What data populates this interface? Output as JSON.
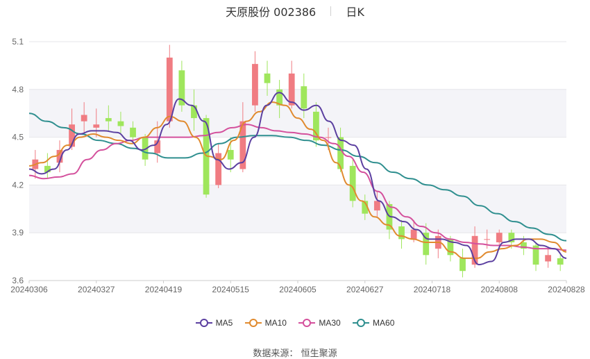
{
  "header": {
    "stock": "天原股份 002386",
    "period": "日K"
  },
  "source": {
    "prefix": "数据来源：",
    "name": "恒生聚源"
  },
  "chart_data": {
    "type": "candlestick",
    "title": "天原股份 002386",
    "period": "日K",
    "ylim": [
      3.6,
      5.1
    ],
    "y_ticks": [
      "3.6",
      "3.9",
      "4.2",
      "4.5",
      "4.8",
      "5.1"
    ],
    "x_ticks": [
      "20240306",
      "20240327",
      "20240419",
      "20240515",
      "20240605",
      "20240627",
      "20240718",
      "20240808",
      "20240828"
    ],
    "up_color": "#f07c82",
    "down_color": "#9fe65c",
    "legend_position": "bottom",
    "series": [
      {
        "name": "MA5",
        "color": "#5b3fa0"
      },
      {
        "name": "MA10",
        "color": "#e08a2e"
      },
      {
        "name": "MA30",
        "color": "#d4509c"
      },
      {
        "name": "MA60",
        "color": "#2f8f8f"
      }
    ],
    "ma5": [
      4.3,
      4.27,
      4.3,
      4.42,
      4.52,
      4.54,
      4.54,
      4.53,
      4.48,
      4.42,
      4.45,
      4.58,
      4.74,
      4.7,
      4.6,
      4.36,
      4.3,
      4.34,
      4.5,
      4.7,
      4.78,
      4.72,
      4.67,
      4.7,
      4.6,
      4.48,
      4.45,
      4.3,
      4.1,
      4.0,
      3.97,
      3.92,
      3.86,
      3.86,
      3.84,
      3.82,
      3.7,
      3.72,
      3.84,
      3.86,
      3.86,
      3.82,
      3.8,
      3.74
    ],
    "ma10": [
      4.32,
      4.34,
      4.38,
      4.45,
      4.5,
      4.52,
      4.5,
      4.48,
      4.46,
      4.5,
      4.56,
      4.63,
      4.6,
      4.5,
      4.38,
      4.36,
      4.48,
      4.6,
      4.66,
      4.72,
      4.7,
      4.62,
      4.55,
      4.48,
      4.34,
      4.2,
      4.1,
      4.0,
      3.95,
      3.88,
      3.86,
      3.84,
      3.84,
      3.78,
      3.74,
      3.74,
      3.78,
      3.8,
      3.82,
      3.86,
      3.86,
      3.84,
      3.78
    ],
    "ma30": [
      4.26,
      4.24,
      4.25,
      4.27,
      4.36,
      4.42,
      4.46,
      4.48,
      4.5,
      4.5,
      4.5,
      4.5,
      4.51,
      4.53,
      4.56,
      4.58,
      4.56,
      4.54,
      4.53,
      4.52,
      4.5,
      4.46,
      4.38,
      4.28,
      4.16,
      4.06,
      4.0,
      3.94,
      3.9,
      3.86,
      3.84,
      3.83,
      3.82,
      3.82,
      3.81,
      3.8,
      3.8,
      3.79
    ],
    "ma60": [
      4.65,
      4.6,
      4.56,
      4.52,
      4.48,
      4.46,
      4.43,
      4.4,
      4.37,
      4.37,
      4.4,
      4.46,
      4.5,
      4.51,
      4.51,
      4.5,
      4.48,
      4.45,
      4.42,
      4.38,
      4.34,
      4.28,
      4.24,
      4.2,
      4.17,
      4.13,
      4.07,
      4.02,
      3.97,
      3.93,
      3.89,
      3.85
    ],
    "candles": [
      [
        4.3,
        4.36,
        4.24,
        4.42
      ],
      [
        4.32,
        4.28,
        4.24,
        4.4
      ],
      [
        4.34,
        4.42,
        4.28,
        4.48
      ],
      [
        4.44,
        4.58,
        4.42,
        4.68
      ],
      [
        4.6,
        4.64,
        4.52,
        4.72
      ],
      [
        4.56,
        4.58,
        4.5,
        4.68
      ],
      [
        4.62,
        4.6,
        4.54,
        4.7
      ],
      [
        4.6,
        4.57,
        4.52,
        4.66
      ],
      [
        4.56,
        4.5,
        4.46,
        4.6
      ],
      [
        4.5,
        4.36,
        4.32,
        4.52
      ],
      [
        4.4,
        4.48,
        4.34,
        4.6
      ],
      [
        4.6,
        5.0,
        4.56,
        5.08
      ],
      [
        4.92,
        4.7,
        4.66,
        4.98
      ],
      [
        4.7,
        4.62,
        4.54,
        4.8
      ],
      [
        4.62,
        4.14,
        4.12,
        4.64
      ],
      [
        4.2,
        4.4,
        4.18,
        4.46
      ],
      [
        4.42,
        4.36,
        4.28,
        4.5
      ],
      [
        4.3,
        4.6,
        4.28,
        4.72
      ],
      [
        4.7,
        4.96,
        4.66,
        5.04
      ],
      [
        4.9,
        4.84,
        4.76,
        4.98
      ],
      [
        4.8,
        4.7,
        4.62,
        4.86
      ],
      [
        4.7,
        4.9,
        4.68,
        4.98
      ],
      [
        4.82,
        4.68,
        4.62,
        4.9
      ],
      [
        4.66,
        4.48,
        4.44,
        4.72
      ],
      [
        4.5,
        4.5,
        4.42,
        4.56
      ],
      [
        4.5,
        4.3,
        4.28,
        4.56
      ],
      [
        4.32,
        4.1,
        4.06,
        4.36
      ],
      [
        4.1,
        4.02,
        3.98,
        4.14
      ],
      [
        4.04,
        4.1,
        4.0,
        4.16
      ],
      [
        4.08,
        3.92,
        3.86,
        4.1
      ],
      [
        3.94,
        3.86,
        3.8,
        3.98
      ],
      [
        3.86,
        3.92,
        3.84,
        3.98
      ],
      [
        3.9,
        3.76,
        3.7,
        3.96
      ],
      [
        3.8,
        3.88,
        3.74,
        3.92
      ],
      [
        3.86,
        3.76,
        3.72,
        3.88
      ],
      [
        3.74,
        3.66,
        3.62,
        3.8
      ],
      [
        3.7,
        3.88,
        3.68,
        3.94
      ],
      [
        3.86,
        3.86,
        3.8,
        3.92
      ],
      [
        3.84,
        3.9,
        3.8,
        3.92
      ],
      [
        3.9,
        3.84,
        3.8,
        3.92
      ],
      [
        3.84,
        3.8,
        3.76,
        3.88
      ],
      [
        3.82,
        3.7,
        3.66,
        3.84
      ],
      [
        3.72,
        3.76,
        3.68,
        3.8
      ],
      [
        3.74,
        3.7,
        3.66,
        3.76
      ]
    ]
  }
}
